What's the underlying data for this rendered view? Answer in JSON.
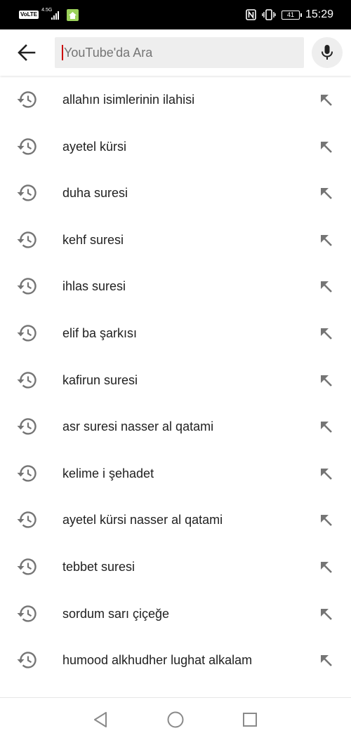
{
  "status_bar": {
    "volte": "VoLTE",
    "network_type": "4.5G",
    "battery": "41",
    "time": "15:29"
  },
  "search": {
    "placeholder": "YouTube'da Ara",
    "value": ""
  },
  "history": [
    {
      "text": "allahın isimlerinin ilahisi"
    },
    {
      "text": "ayetel kürsi"
    },
    {
      "text": "duha suresi"
    },
    {
      "text": "kehf suresi"
    },
    {
      "text": "ihlas suresi"
    },
    {
      "text": "elif ba şarkısı"
    },
    {
      "text": "kafirun suresi"
    },
    {
      "text": "asr suresi nasser al qatami"
    },
    {
      "text": "kelime i şehadet"
    },
    {
      "text": "ayetel kürsi nasser al qatami"
    },
    {
      "text": "tebbet suresi"
    },
    {
      "text": "sordum sarı çiçeğe"
    },
    {
      "text": "humood alkhudher lughat alkalam"
    }
  ],
  "icons": {
    "back": "arrow-back-icon",
    "mic": "microphone-icon",
    "history": "history-icon",
    "fill": "arrow-up-left-icon",
    "nav_back": "triangle-back-icon",
    "nav_home": "circle-home-icon",
    "nav_recents": "square-recents-icon"
  },
  "colors": {
    "status_bar": "#000000",
    "search_bg": "#eeeeee",
    "text": "#212121",
    "placeholder": "#757575",
    "icon": "#757575",
    "caret": "#cc0000"
  }
}
